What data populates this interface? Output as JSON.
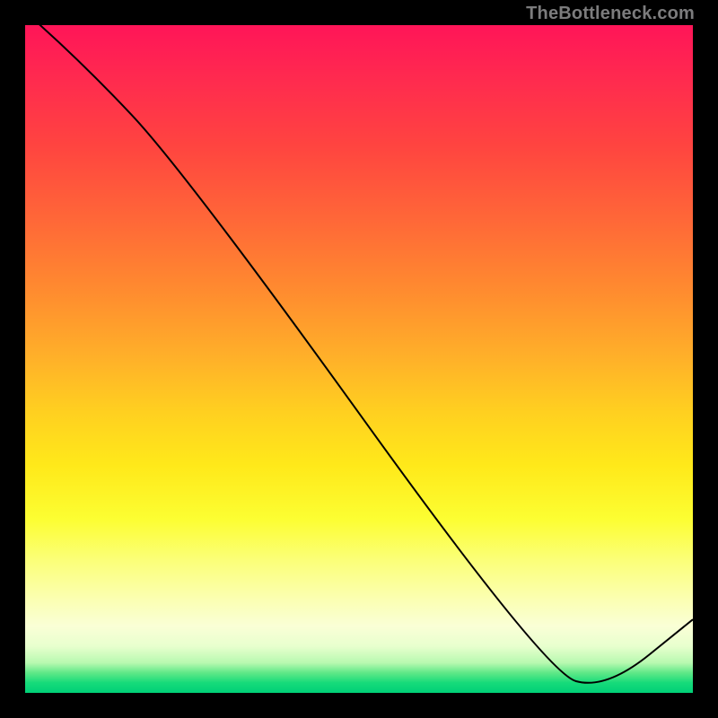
{
  "attribution": "TheBottleneck.com",
  "difficulty_label": "",
  "chart_data": {
    "type": "line",
    "title": "",
    "xlabel": "",
    "ylabel": "",
    "xlim": [
      0,
      100
    ],
    "ylim": [
      0,
      100
    ],
    "grid": false,
    "legend": false,
    "x": [
      0,
      8,
      24,
      78,
      87,
      100
    ],
    "values": [
      102,
      95,
      78,
      3,
      0.5,
      11
    ],
    "notes": "Black curve descending from top-left, gentle then steeper bend near x≈24, nearly linear descent to a minimum around x≈85-88 at y≈0, then rising to y≈11 at x=100. Background vertical gradient from red (high y) through orange/yellow to pale-yellow then green (low y)."
  },
  "colors": {
    "frame": "#000000",
    "line": "#000000",
    "attribution_text": "#7c7c7d",
    "difficulty_text": "#d83a3b",
    "gradient_top": "#ff1558",
    "gradient_bottom": "#00d077"
  }
}
